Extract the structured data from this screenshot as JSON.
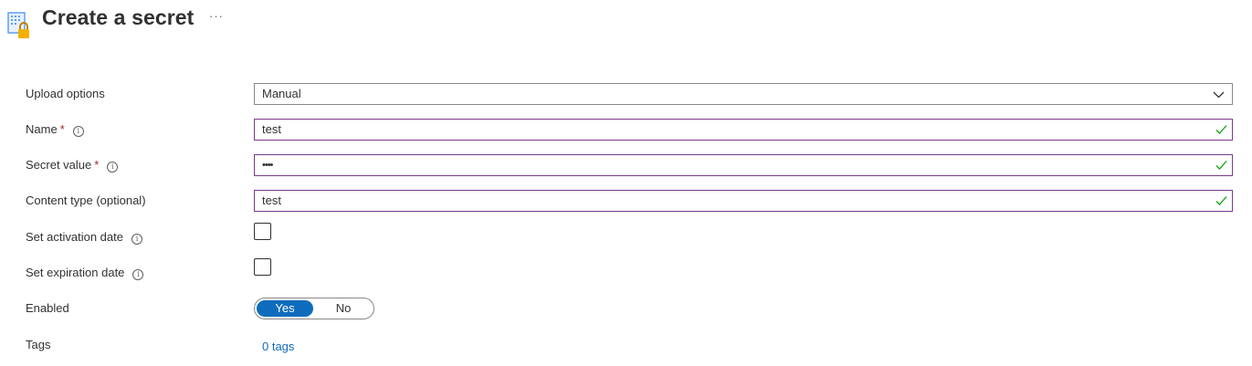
{
  "header": {
    "title": "Create a secret",
    "more_label": "···"
  },
  "form": {
    "upload_options": {
      "label": "Upload options",
      "value": "Manual"
    },
    "name": {
      "label": "Name",
      "required_mark": "*",
      "value": "test"
    },
    "secret_value": {
      "label": "Secret value",
      "required_mark": "*",
      "value": "••••"
    },
    "content_type": {
      "label": "Content type (optional)",
      "value": "test"
    },
    "activation_date": {
      "label": "Set activation date",
      "checked": false
    },
    "expiration_date": {
      "label": "Set expiration date",
      "checked": false
    },
    "enabled": {
      "label": "Enabled",
      "options": [
        "Yes",
        "No"
      ],
      "selected": "Yes"
    },
    "tags": {
      "label": "Tags",
      "link_text": "0 tags"
    }
  },
  "icons": {
    "info": "info-icon",
    "dropdown": "chevron-down-icon",
    "valid": "checkmark-icon",
    "page": "key-vault-secret-icon"
  },
  "colors": {
    "accent": "#0f6cbd",
    "valid_border": "#7c3a8a",
    "valid_check": "#13a10e",
    "required": "#a4262c"
  }
}
